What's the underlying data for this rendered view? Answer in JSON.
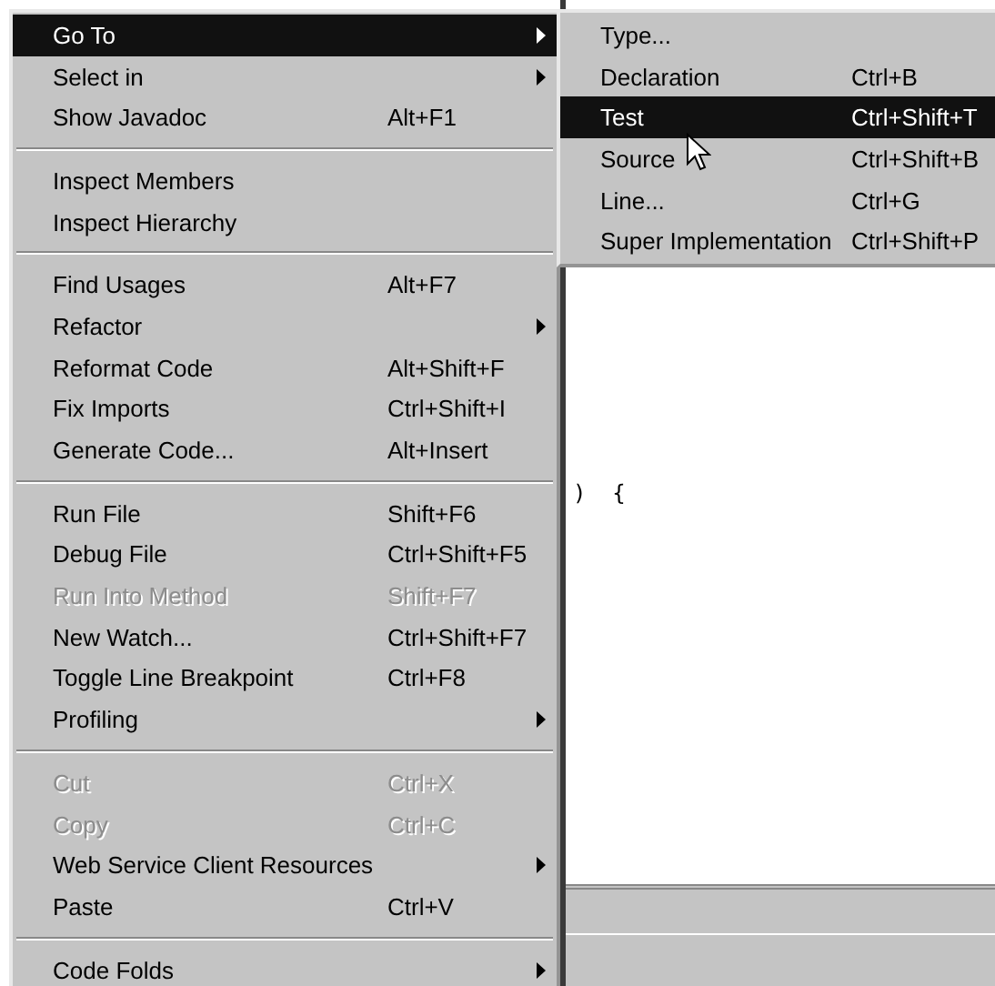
{
  "editor": {
    "code_line": ")  {"
  },
  "context_menu": {
    "items": [
      {
        "kind": "item",
        "label": "Go To",
        "submenu": true,
        "disabled": false,
        "selected": true
      },
      {
        "kind": "item",
        "label": "Select in",
        "submenu": true,
        "disabled": false,
        "selected": false
      },
      {
        "kind": "item",
        "label": "Show Javadoc",
        "shortcut": "Alt+F1",
        "submenu": false,
        "disabled": false,
        "selected": false
      },
      {
        "kind": "separator"
      },
      {
        "kind": "item",
        "label": "Inspect Members",
        "submenu": false,
        "disabled": false,
        "selected": false
      },
      {
        "kind": "item",
        "label": "Inspect Hierarchy",
        "submenu": false,
        "disabled": false,
        "selected": false
      },
      {
        "kind": "separator"
      },
      {
        "kind": "item",
        "label": "Find Usages",
        "shortcut": "Alt+F7",
        "submenu": false,
        "disabled": false,
        "selected": false
      },
      {
        "kind": "item",
        "label": "Refactor",
        "submenu": true,
        "disabled": false,
        "selected": false
      },
      {
        "kind": "item",
        "label": "Reformat Code",
        "shortcut": "Alt+Shift+F",
        "submenu": false,
        "disabled": false,
        "selected": false
      },
      {
        "kind": "item",
        "label": "Fix Imports",
        "shortcut": "Ctrl+Shift+I",
        "submenu": false,
        "disabled": false,
        "selected": false
      },
      {
        "kind": "item",
        "label": "Generate Code...",
        "shortcut": "Alt+Insert",
        "submenu": false,
        "disabled": false,
        "selected": false
      },
      {
        "kind": "separator"
      },
      {
        "kind": "item",
        "label": "Run File",
        "shortcut": "Shift+F6",
        "submenu": false,
        "disabled": false,
        "selected": false
      },
      {
        "kind": "item",
        "label": "Debug File",
        "shortcut": "Ctrl+Shift+F5",
        "submenu": false,
        "disabled": false,
        "selected": false
      },
      {
        "kind": "item",
        "label": "Run Into Method",
        "shortcut": "Shift+F7",
        "submenu": false,
        "disabled": true,
        "selected": false
      },
      {
        "kind": "item",
        "label": "New Watch...",
        "shortcut": "Ctrl+Shift+F7",
        "submenu": false,
        "disabled": false,
        "selected": false
      },
      {
        "kind": "item",
        "label": "Toggle Line Breakpoint",
        "shortcut": "Ctrl+F8",
        "submenu": false,
        "disabled": false,
        "selected": false
      },
      {
        "kind": "item",
        "label": "Profiling",
        "submenu": true,
        "disabled": false,
        "selected": false
      },
      {
        "kind": "separator"
      },
      {
        "kind": "item",
        "label": "Cut",
        "shortcut": "Ctrl+X",
        "submenu": false,
        "disabled": true,
        "selected": false
      },
      {
        "kind": "item",
        "label": "Copy",
        "shortcut": "Ctrl+C",
        "submenu": false,
        "disabled": true,
        "selected": false
      },
      {
        "kind": "item",
        "label": "Web Service Client Resources",
        "submenu": true,
        "disabled": false,
        "selected": false
      },
      {
        "kind": "item",
        "label": "Paste",
        "shortcut": "Ctrl+V",
        "submenu": false,
        "disabled": false,
        "selected": false
      },
      {
        "kind": "separator"
      },
      {
        "kind": "item",
        "label": "Code Folds",
        "submenu": true,
        "disabled": false,
        "selected": false
      }
    ]
  },
  "submenu": {
    "items": [
      {
        "label": "Type...",
        "selected": false
      },
      {
        "label": "Declaration",
        "shortcut": "Ctrl+B",
        "selected": false
      },
      {
        "label": "Test",
        "shortcut": "Ctrl+Shift+T",
        "selected": true
      },
      {
        "label": "Source",
        "shortcut": "Ctrl+Shift+B",
        "selected": false
      },
      {
        "label": "Line...",
        "shortcut": "Ctrl+G",
        "selected": false
      },
      {
        "label": "Super Implementation",
        "shortcut": "Ctrl+Shift+P",
        "selected": false
      }
    ]
  }
}
